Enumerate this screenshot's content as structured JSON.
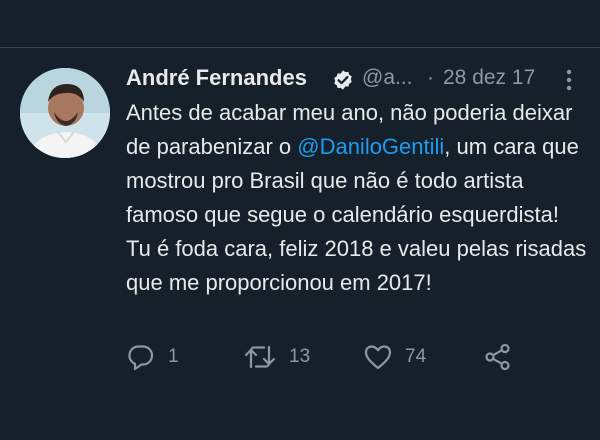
{
  "tweet": {
    "author_name": "André Fernandes",
    "handle": "@a...",
    "separator": "·",
    "date": "28 dez 17",
    "text_before": "Antes de acabar meu ano, não poderia deixar de parabenizar o ",
    "mention": "@DaniloGentili",
    "text_after": ", um cara que mostrou pro Brasil que não é todo artista famoso que segue o calendário esquerdista! Tu é foda cara, feliz 2018 e valeu pelas risadas que me proporcionou em 2017!",
    "replies": "1",
    "retweets": "13",
    "likes": "74"
  },
  "icons": {
    "verified": "verified-badge-icon",
    "more": "more-vertical-icon",
    "reply": "reply-icon",
    "retweet": "retweet-icon",
    "like": "heart-icon",
    "share": "share-icon"
  },
  "colors": {
    "background": "#15202b",
    "text": "#e7e9ea",
    "secondary": "#8b98a5",
    "mention": "#1d9bf0"
  }
}
